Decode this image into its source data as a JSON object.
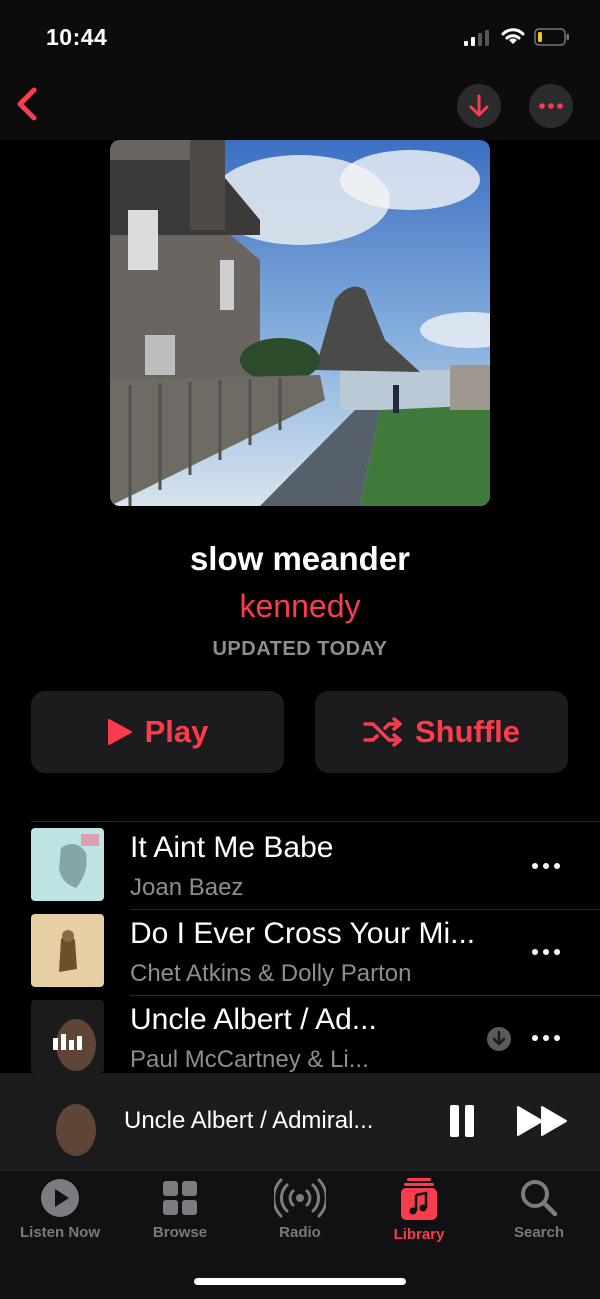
{
  "status_bar": {
    "time": "10:44"
  },
  "playlist": {
    "title": "slow meander",
    "curator": "kennedy",
    "updated": "UPDATED TODAY"
  },
  "actions": {
    "play_label": "Play",
    "shuffle_label": "Shuffle"
  },
  "tracks": [
    {
      "title": "It Aint Me Babe",
      "artist": "Joan Baez"
    },
    {
      "title": "Do I Ever Cross Your Mi...",
      "artist": "Chet Atkins & Dolly Parton"
    },
    {
      "title": "Uncle Albert / Ad...",
      "artist": "Paul McCartney & Li..."
    }
  ],
  "now_playing": {
    "title": "Uncle Albert / Admiral..."
  },
  "tabs": [
    {
      "label": "Listen Now",
      "icon": "play-circle-icon"
    },
    {
      "label": "Browse",
      "icon": "grid-icon"
    },
    {
      "label": "Radio",
      "icon": "radio-waves-icon"
    },
    {
      "label": "Library",
      "icon": "music-note-icon"
    },
    {
      "label": "Search",
      "icon": "search-icon"
    }
  ],
  "colors": {
    "accent": "#fa3c4c",
    "secondary_text": "#8d8d92",
    "button_bg": "#1c1c1e"
  }
}
